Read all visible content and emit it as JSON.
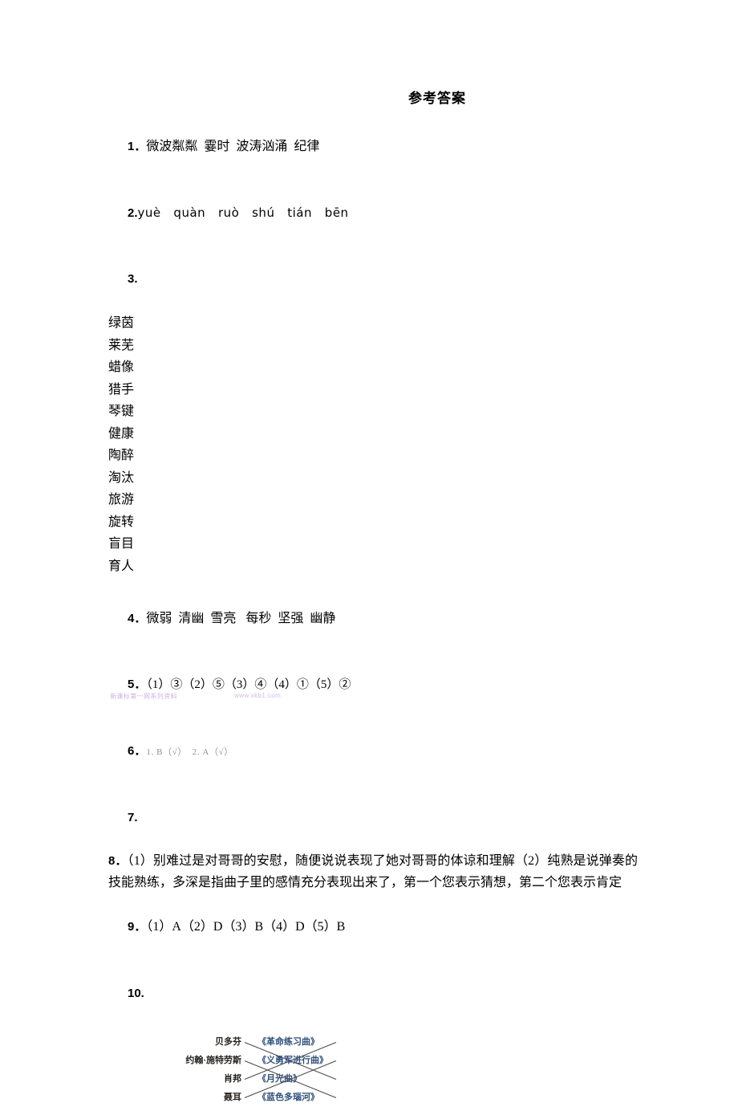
{
  "document": {
    "title": "参考答案",
    "answers": [
      {
        "number": "1．",
        "text": "微波粼粼  霎时  波涛汹涌  纪律"
      },
      {
        "number": "2.",
        "text": "yuè   quàn   ruò   shú   tián   bēn"
      },
      {
        "number": "3.",
        "text": ""
      },
      {
        "number": "4．",
        "text": "微弱  清幽  雪亮   每秒  坚强  幽静"
      },
      {
        "number": "5．",
        "text": "（1）③（2）⑤（3）④（4）①（5）②"
      },
      {
        "number": "6．",
        "text": "1. B（√）  2. A（√）"
      },
      {
        "number": "7.",
        "text": ""
      },
      {
        "number": "8．",
        "text": "（1）别难过是对哥哥的安慰，随便说说表现了她对哥哥的体谅和理解（2）纯熟是说弹奏的技能熟练，多深是指曲子里的感情充分表现出来了，第一个您表示猜想，第二个您表示肯定"
      },
      {
        "number": "9．",
        "text": "（1）A（2）D（3）B（4）D（5）B"
      },
      {
        "number": "10.",
        "text": ""
      }
    ],
    "word_list": [
      "绿茵",
      "莱芜",
      "蜡像",
      "猎手",
      "琴键",
      "健康",
      "陶醉",
      "淘汰",
      "旅游",
      "旋转",
      "盲目",
      "育人"
    ],
    "matching": {
      "left_items": [
        "贝多芬",
        "约翰·施特劳斯",
        "肖邦",
        "聂耳"
      ],
      "right_items": [
        "《革命练习曲》",
        "《义勇军进行曲》",
        "《月光曲》",
        "《蓝色多瑙河》"
      ],
      "connections": [
        {
          "from": 0,
          "to": 2
        },
        {
          "from": 1,
          "to": 3
        },
        {
          "from": 2,
          "to": 0
        },
        {
          "from": 3,
          "to": 1
        }
      ]
    },
    "footer": {
      "label": "新课标第一网系列资料",
      "site": "www.xkb1.com"
    }
  }
}
